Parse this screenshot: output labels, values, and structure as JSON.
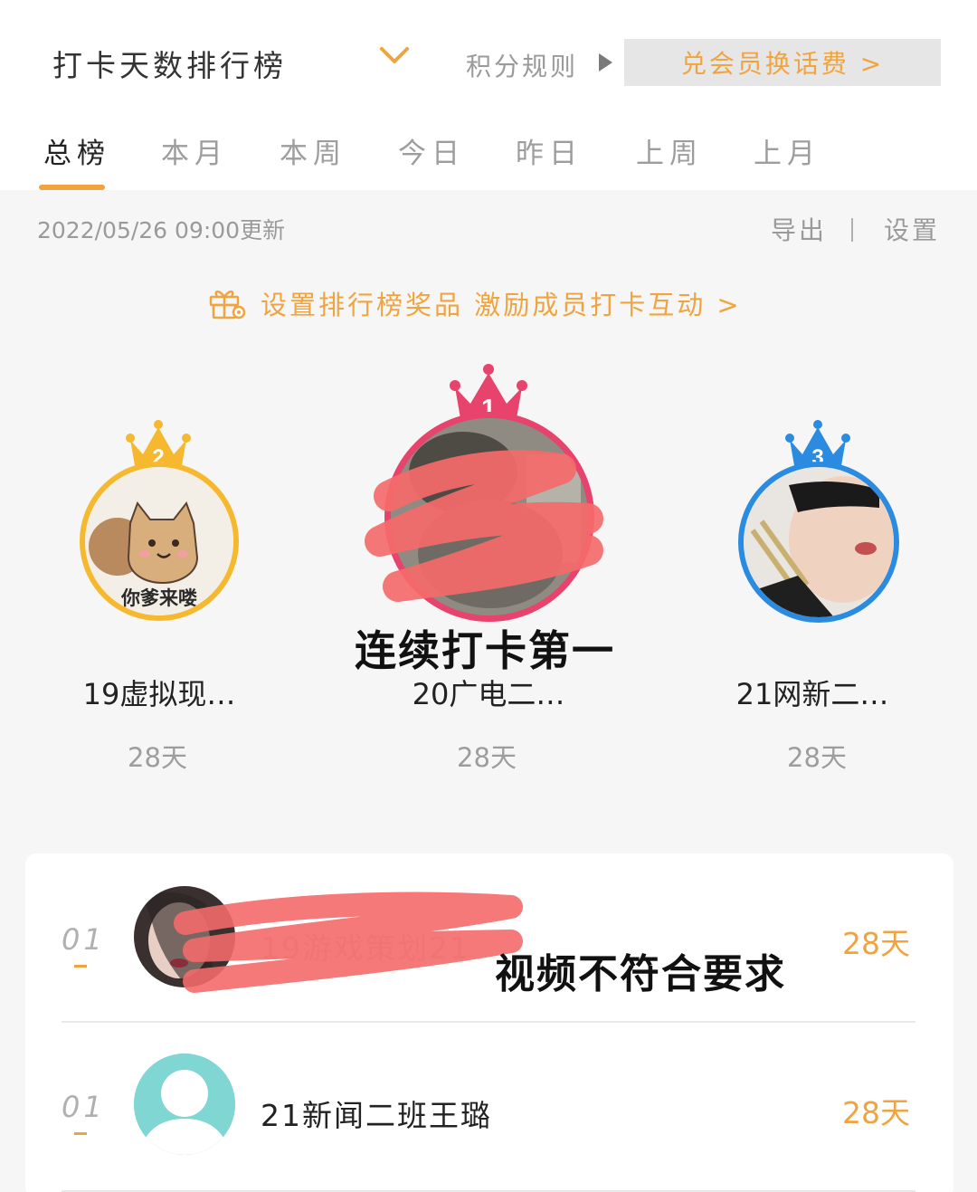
{
  "header": {
    "title": "打卡天数排行榜",
    "rules_label": "积分规则",
    "redeem_label": "兑会员换话费 >"
  },
  "tabs": [
    "总榜",
    "本月",
    "本周",
    "今日",
    "昨日",
    "上周",
    "上月"
  ],
  "active_tab": "总榜",
  "toolbar": {
    "update_time": "2022/05/26 09:00更新",
    "export_label": "导出",
    "separator": "|",
    "settings_label": "设置"
  },
  "promo": {
    "text": "设置排行榜奖品 激励成员打卡互动 >"
  },
  "podium": [
    {
      "rank": "2",
      "name": "19虚拟现…",
      "days": "28天",
      "avatar_caption": "你爹来喽",
      "color": "#f5b82e"
    },
    {
      "rank": "1",
      "name": "20广电二…",
      "days": "28天",
      "color": "#e8436d"
    },
    {
      "rank": "3",
      "name": "21网新二…",
      "days": "28天",
      "color": "#2a8be0"
    }
  ],
  "overlay_captions": {
    "podium": "连续打卡第一",
    "list": "视频不符合要求"
  },
  "list": [
    {
      "rank": "01",
      "name": "19游戏策划21",
      "days": "28天"
    },
    {
      "rank": "01",
      "name": "21新闻二班王璐",
      "days": "28天"
    }
  ],
  "colors": {
    "accent": "#f0a440",
    "gold": "#f5b82e",
    "pink": "#e8436d",
    "blue": "#2a8be0",
    "default_avatar": "#7fd6d3",
    "scribble": "#f46a6a"
  }
}
